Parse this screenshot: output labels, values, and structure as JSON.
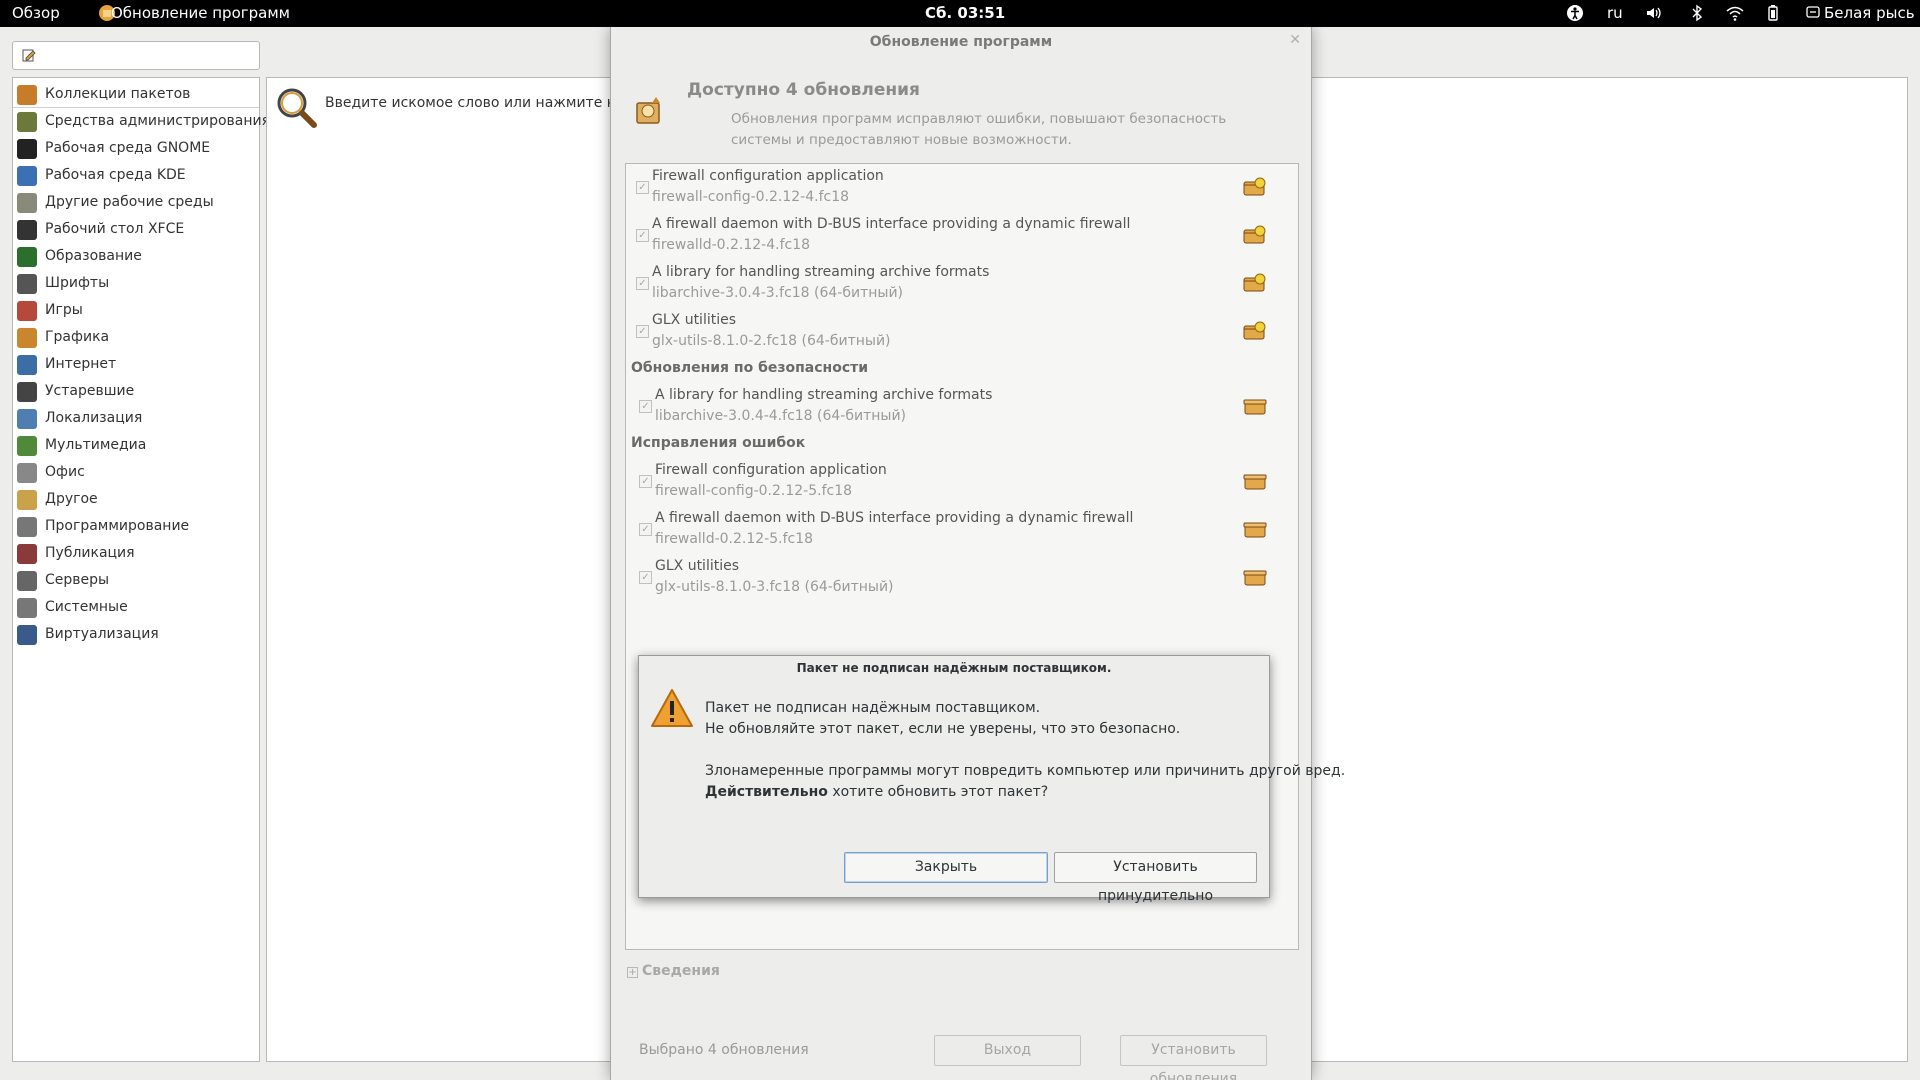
{
  "topbar": {
    "overview": "Обзор",
    "app_name": "Обновление программ",
    "clock": "Сб. 03:51",
    "lang": "ru",
    "user": "Белая рысь"
  },
  "background": {
    "search_hint": "Введите искомое слово или нажмите на кат",
    "sidebar": [
      {
        "label": "Коллекции пакетов",
        "icon": "package-collections-icon",
        "color": "#c77c2a"
      },
      {
        "label": "Средства администрирования",
        "icon": "admin-tools-icon",
        "color": "#6b7a3a"
      },
      {
        "label": "Рабочая среда GNOME",
        "icon": "gnome-foot-icon",
        "color": "#222222"
      },
      {
        "label": "Рабочая среда KDE",
        "icon": "kde-icon",
        "color": "#3d6fb3"
      },
      {
        "label": "Другие рабочие среды",
        "icon": "other-desktops-icon",
        "color": "#8a8a7a"
      },
      {
        "label": "Рабочий стол XFCE",
        "icon": "xfce-mouse-icon",
        "color": "#333333"
      },
      {
        "label": "Образование",
        "icon": "education-icon",
        "color": "#2c6e2c"
      },
      {
        "label": "Шрифты",
        "icon": "fonts-icon",
        "color": "#555555"
      },
      {
        "label": "Игры",
        "icon": "games-icon",
        "color": "#b54a3a"
      },
      {
        "label": "Графика",
        "icon": "graphics-icon",
        "color": "#c9862e"
      },
      {
        "label": "Интернет",
        "icon": "internet-globe-icon",
        "color": "#3a6ea5"
      },
      {
        "label": "Устаревшие",
        "icon": "floppy-icon",
        "color": "#444444"
      },
      {
        "label": "Локализация",
        "icon": "localization-map-icon",
        "color": "#4f7fb0"
      },
      {
        "label": "Мультимедиа",
        "icon": "multimedia-icon",
        "color": "#4f8a3a"
      },
      {
        "label": "Офис",
        "icon": "office-icon",
        "color": "#888888"
      },
      {
        "label": "Другое",
        "icon": "other-box-icon",
        "color": "#c9a24a"
      },
      {
        "label": "Программирование",
        "icon": "programming-icon",
        "color": "#777777"
      },
      {
        "label": "Публикация",
        "icon": "publishing-icon",
        "color": "#8a3a3a"
      },
      {
        "label": "Серверы",
        "icon": "servers-icon",
        "color": "#666666"
      },
      {
        "label": "Системные",
        "icon": "system-gear-icon",
        "color": "#777777"
      },
      {
        "label": "Виртуализация",
        "icon": "virtualization-icon",
        "color": "#3a5a8a"
      }
    ]
  },
  "update_dialog": {
    "title": "Обновление программ",
    "heading": "Доступно 4 обновления",
    "description": "Обновления программ исправляют ошибки, повышают безопасность системы и предоставляют новые возможности.",
    "enhancements": [
      {
        "summary": "Firewall configuration application",
        "package": "firewall-config-0.2.12-4.fc18"
      },
      {
        "summary": "A firewall daemon with D-BUS interface providing a dynamic firewall",
        "package": "firewalld-0.2.12-4.fc18"
      },
      {
        "summary": "A library for handling streaming archive formats",
        "package": "libarchive-3.0.4-3.fc18 (64-битный)"
      },
      {
        "summary": "GLX utilities",
        "package": "glx-utils-8.1.0-2.fc18 (64-битный)"
      }
    ],
    "security_header": "Обновления по безопасности",
    "security": [
      {
        "summary": "A library for handling streaming archive formats",
        "package": "libarchive-3.0.4-4.fc18 (64-битный)"
      }
    ],
    "bugfix_header": "Исправления ошибок",
    "bugfix": [
      {
        "summary": "Firewall configuration application",
        "package": "firewall-config-0.2.12-5.fc18"
      },
      {
        "summary": "A firewall daemon with D-BUS interface providing a dynamic firewall",
        "package": "firewalld-0.2.12-5.fc18"
      },
      {
        "summary": "GLX utilities",
        "package": "glx-utils-8.1.0-3.fc18 (64-битный)"
      }
    ],
    "details_label": "Сведения",
    "selected_count": "Выбрано 4 обновления",
    "exit_button": "Выход",
    "install_button": "Установить обновления"
  },
  "alert": {
    "title": "Пакет не подписан надёжным поставщиком.",
    "line1": "Пакет не подписан надёжным поставщиком.",
    "line2": "Не обновляйте этот пакет, если не уверены, что это безопасно.",
    "line3": "Злонамеренные программы могут повредить компьютер или причинить другой вред.",
    "line4_bold": "Действительно",
    "line4_rest": " хотите обновить этот пакет?",
    "close_button": "Закрыть",
    "force_button": "Установить принудительно"
  }
}
